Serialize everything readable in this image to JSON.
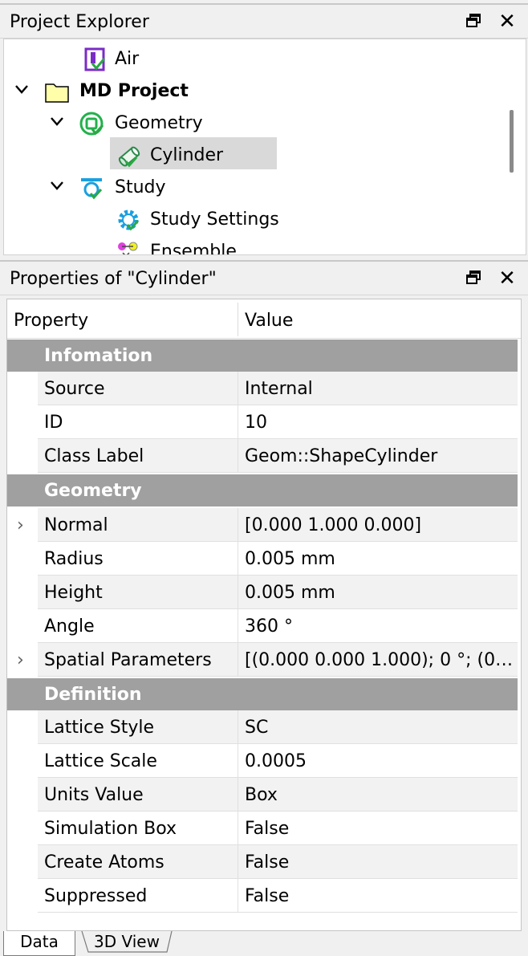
{
  "explorer": {
    "title": "Project Explorer",
    "tree": [
      {
        "label": "Air",
        "icon": "material-icon",
        "expanded": null,
        "bold": false
      },
      {
        "label": "MD Project",
        "icon": "folder-icon",
        "expanded": true,
        "bold": true
      },
      {
        "label": "Geometry",
        "icon": "geometry-icon",
        "expanded": true,
        "bold": false
      },
      {
        "label": "Cylinder",
        "icon": "cylinder-icon",
        "expanded": null,
        "bold": false,
        "selected": true
      },
      {
        "label": "Study",
        "icon": "study-icon",
        "expanded": true,
        "bold": false
      },
      {
        "label": "Study Settings",
        "icon": "gear-icon",
        "expanded": null,
        "bold": false
      },
      {
        "label": "Ensemble",
        "icon": "ensemble-icon",
        "expanded": null,
        "bold": false
      }
    ]
  },
  "properties": {
    "title": "Properties of \"Cylinder\"",
    "col_property": "Property",
    "col_value": "Value",
    "groups": [
      {
        "name": "Infomation",
        "rows": [
          {
            "key": "Source",
            "value": "Internal"
          },
          {
            "key": "ID",
            "value": "10"
          },
          {
            "key": "Class Label",
            "value": "Geom::ShapeCylinder"
          }
        ]
      },
      {
        "name": "Geometry",
        "rows": [
          {
            "key": "Normal",
            "value": "[0.000 1.000 0.000]",
            "expandable": true
          },
          {
            "key": "Radius",
            "value": "0.005 mm"
          },
          {
            "key": "Height",
            "value": "0.005 mm"
          },
          {
            "key": "Angle",
            "value": "360 °"
          },
          {
            "key": "Spatial Parameters",
            "value": "[(0.000 0.000 1.000); 0 °; (0 -0....",
            "expandable": true
          }
        ]
      },
      {
        "name": "Definition",
        "rows": [
          {
            "key": "Lattice Style",
            "value": "SC"
          },
          {
            "key": "Lattice Scale",
            "value": "0.0005"
          },
          {
            "key": "Units Value",
            "value": "Box"
          },
          {
            "key": "Simulation Box",
            "value": "False"
          },
          {
            "key": "Create Atoms",
            "value": "False"
          },
          {
            "key": "Suppressed",
            "value": "False"
          }
        ]
      }
    ]
  },
  "tabs": [
    {
      "label": "Data",
      "active": true
    },
    {
      "label": "3D View",
      "active": false
    }
  ],
  "colors": {
    "check": "#2aa845",
    "geometry": "#22b14c",
    "study": "#1a9fe0",
    "material": "#7a2cc7",
    "folder": "#ffffaa"
  }
}
